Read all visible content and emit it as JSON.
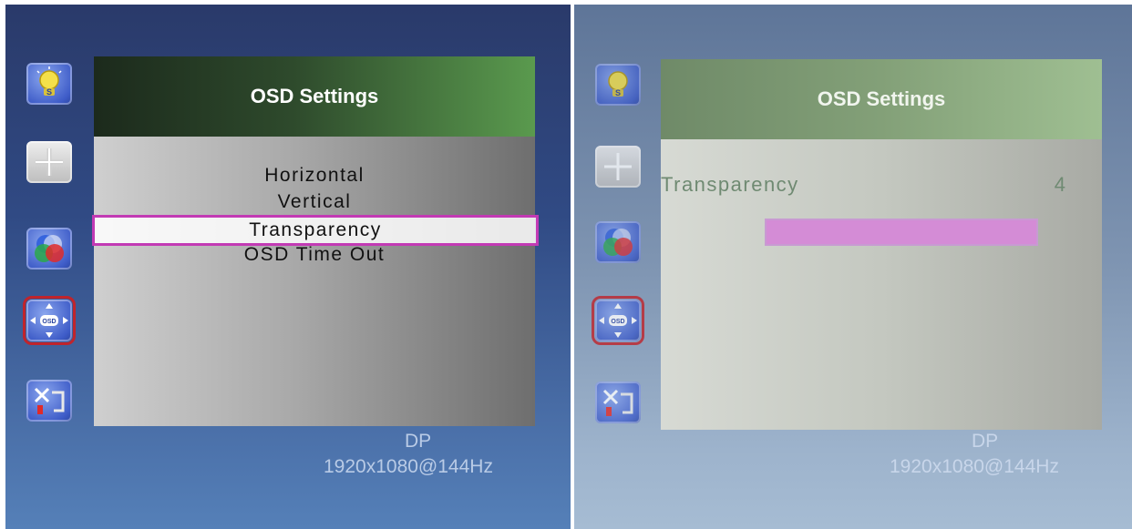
{
  "left_screen": {
    "osd_title": "OSD Settings",
    "menu_items": [
      "Horizontal",
      "Vertical",
      "Transparency",
      "OSD Time Out"
    ],
    "selected_item": "Transparency",
    "input_source": "DP",
    "resolution": "1920x1080@144Hz"
  },
  "right_screen": {
    "osd_title": "OSD Settings",
    "setting_label": "Transparency",
    "setting_value": "4",
    "slider_level_fraction": 1.0,
    "input_source": "DP",
    "resolution": "1920x1080@144Hz"
  },
  "icons": [
    "brightness-bulb-icon",
    "position-arrows-icon",
    "color-rgb-icon",
    "osd-settings-icon",
    "tools-icon"
  ],
  "colors": {
    "selection_border": "#c23ab4",
    "slider_fill": "#d48cd6",
    "selected_icon_border": "#c0242c",
    "header_green": "#5a9a4e"
  }
}
